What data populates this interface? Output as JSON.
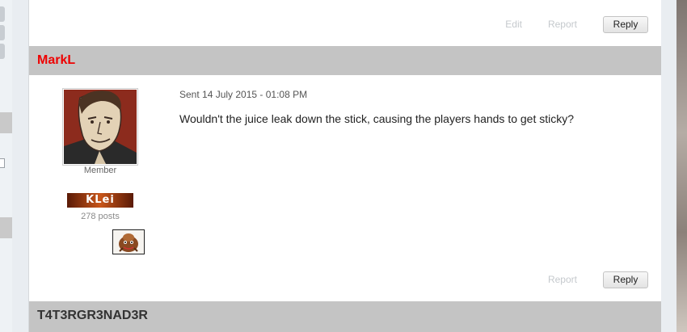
{
  "posts": [
    {
      "author": "MarkL",
      "sent": "Sent 14 July 2015 - 01:08 PM",
      "rank": "Member",
      "badge": "KLei",
      "post_count": "278 posts",
      "body": "Wouldn't the juice leak down the stick, causing the players hands to get sticky?",
      "actions": {
        "report": "Report",
        "reply": "Reply"
      }
    },
    {
      "author": "T4T3RGR3NAD3R"
    }
  ],
  "previous_post_actions": {
    "edit": "Edit",
    "report": "Report",
    "reply": "Reply"
  },
  "icons": {
    "avatar": "cartoon-man-portrait",
    "badge": "klei-logo",
    "mini": "creature-icon"
  },
  "colors": {
    "author_highlight": "#ee0000",
    "header_band": "#c4c4c4"
  }
}
